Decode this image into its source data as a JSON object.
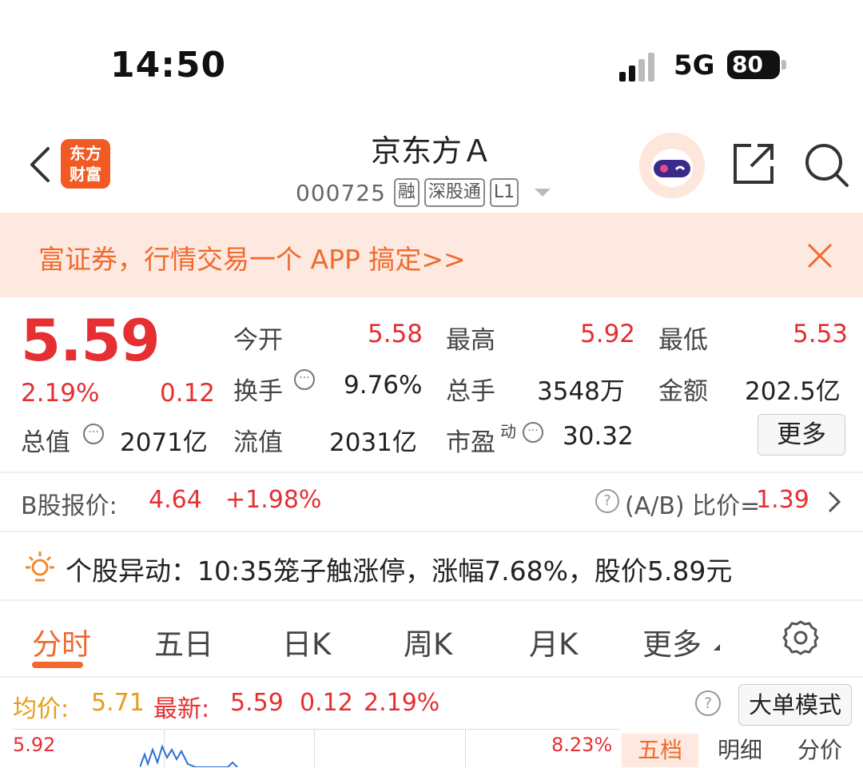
{
  "status_bar": {
    "time": "14:50",
    "network": "5G",
    "battery": "80"
  },
  "header": {
    "logo_text": [
      "东方",
      "财富"
    ],
    "stock_name": "京东方Ａ",
    "stock_code": "000725",
    "tags": [
      "融",
      "深股通",
      "L1"
    ]
  },
  "banner": {
    "text": "富证券，行情交易一个 APP 搞定>>"
  },
  "quote": {
    "price": "5.59",
    "change_pct": "2.19%",
    "change": "0.12",
    "total_value_label": "总值",
    "total_value": "2071亿",
    "fields": {
      "open_label": "今开",
      "open": "5.58",
      "high_label": "最高",
      "high": "5.92",
      "low_label": "最低",
      "low": "5.53",
      "turnover_label": "换手",
      "turnover": "9.76%",
      "volume_label": "总手",
      "volume": "3548万",
      "amount_label": "金额",
      "amount": "202.5亿",
      "float_label": "流值",
      "float_value": "2031亿",
      "pe_label": "市盈",
      "pe_sup": "动",
      "pe": "30.32"
    },
    "more_label": "更多"
  },
  "b_share": {
    "label": "B股报价:",
    "price": "4.64",
    "change_pct": "+1.98%",
    "ratio_label": "(A/B) 比价=",
    "ratio": "1.39"
  },
  "alert": {
    "text": "个股异动：10:35笼子触涨停，涨幅7.68%，股价5.89元"
  },
  "tabs": [
    "分时",
    "五日",
    "日K",
    "周K",
    "月K",
    "更多"
  ],
  "intraday": {
    "avg_label": "均价:",
    "avg": "5.71",
    "latest_label": "最新:",
    "latest": "5.59",
    "latest_change": "0.12",
    "latest_pct": "2.19%",
    "big_order_label": "大单模式",
    "y_high": "5.92",
    "pct_high": "8.23%",
    "side_tabs": [
      "五档",
      "明细",
      "分价"
    ]
  },
  "colors": {
    "up": "#e52f32",
    "accent": "#f06a2f",
    "avg": "#e89b1a"
  }
}
